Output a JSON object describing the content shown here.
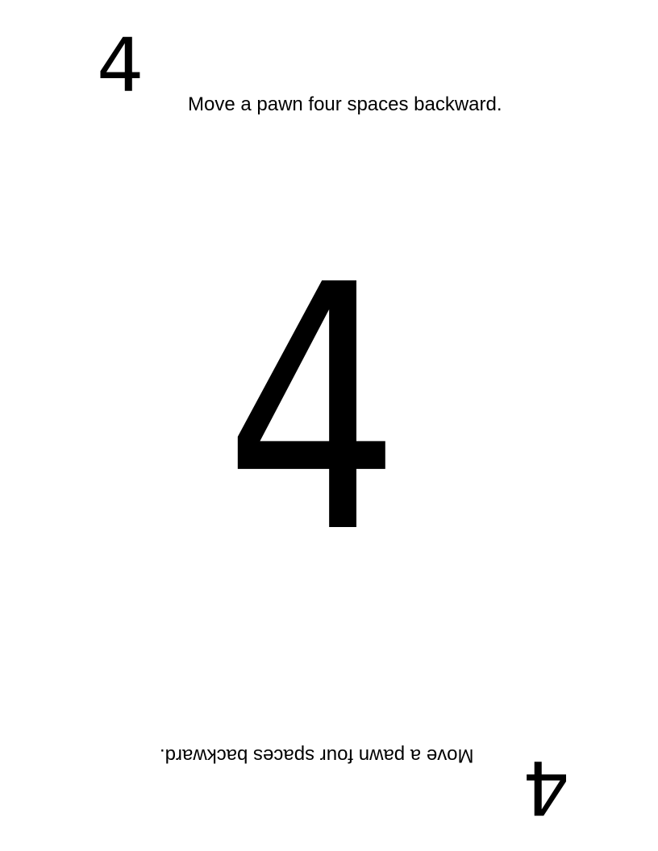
{
  "card": {
    "number": "4",
    "instruction": "Move a pawn four spaces backward."
  }
}
